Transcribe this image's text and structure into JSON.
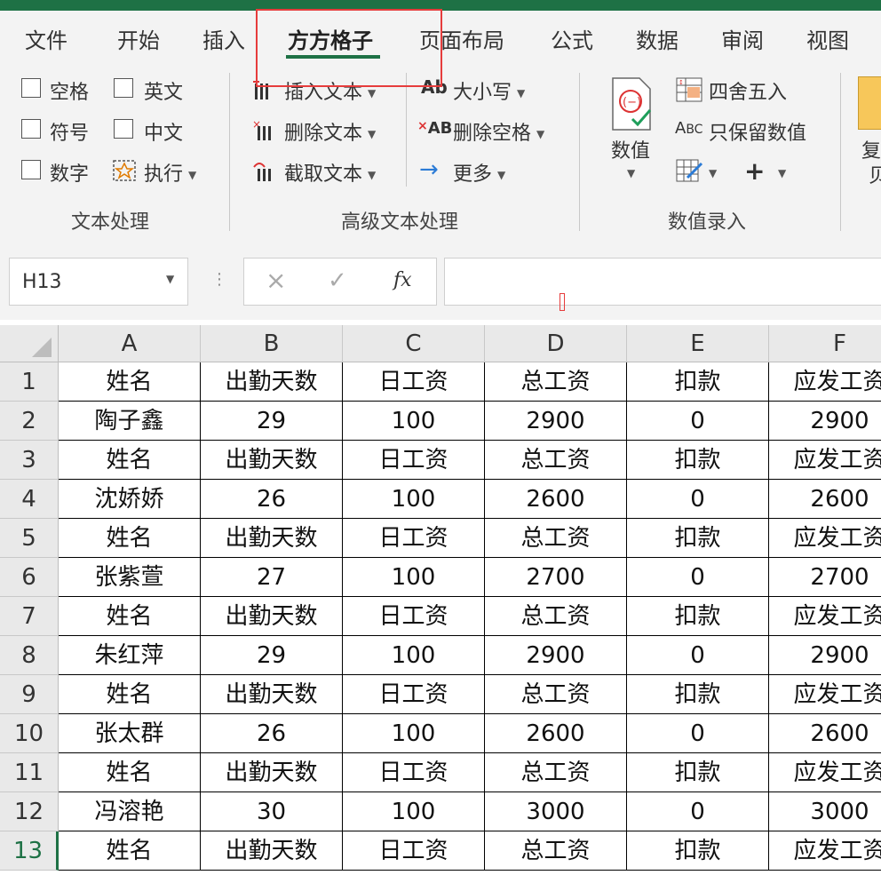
{
  "tabs": [
    {
      "id": "file",
      "label": "文件"
    },
    {
      "id": "home",
      "label": "开始"
    },
    {
      "id": "insert",
      "label": "插入"
    },
    {
      "id": "ffgz",
      "label": "方方格子"
    },
    {
      "id": "layout",
      "label": "页面布局"
    },
    {
      "id": "formula",
      "label": "公式"
    },
    {
      "id": "data",
      "label": "数据"
    },
    {
      "id": "review",
      "label": "审阅"
    },
    {
      "id": "view",
      "label": "视图"
    }
  ],
  "ribbon": {
    "text_group": {
      "title": "文本处理",
      "checkboxes": [
        "空格",
        "英文",
        "符号",
        "中文",
        "数字"
      ],
      "execute": "执行"
    },
    "adv_group": {
      "title": "高级文本处理",
      "insert_text": "插入文本",
      "delete_text": "删除文本",
      "extract_text": "截取文本",
      "case": "大小写",
      "delete_space": "删除空格",
      "more": "更多"
    },
    "num_group": {
      "title": "数值录入",
      "value": "数值",
      "round": "四舍五入",
      "keep_value": "只保留数值"
    },
    "partial": {
      "line1": "复",
      "line2": "贝"
    }
  },
  "formula_bar": {
    "name_box": "H13",
    "fx": "fx"
  },
  "columns": [
    "A",
    "B",
    "C",
    "D",
    "E",
    "F"
  ],
  "rows": [
    [
      "姓名",
      "出勤天数",
      "日工资",
      "总工资",
      "扣款",
      "应发工资"
    ],
    [
      "陶子鑫",
      "29",
      "100",
      "2900",
      "0",
      "2900"
    ],
    [
      "姓名",
      "出勤天数",
      "日工资",
      "总工资",
      "扣款",
      "应发工资"
    ],
    [
      "沈娇娇",
      "26",
      "100",
      "2600",
      "0",
      "2600"
    ],
    [
      "姓名",
      "出勤天数",
      "日工资",
      "总工资",
      "扣款",
      "应发工资"
    ],
    [
      "张紫萱",
      "27",
      "100",
      "2700",
      "0",
      "2700"
    ],
    [
      "姓名",
      "出勤天数",
      "日工资",
      "总工资",
      "扣款",
      "应发工资"
    ],
    [
      "朱红萍",
      "29",
      "100",
      "2900",
      "0",
      "2900"
    ],
    [
      "姓名",
      "出勤天数",
      "日工资",
      "总工资",
      "扣款",
      "应发工资"
    ],
    [
      "张太群",
      "26",
      "100",
      "2600",
      "0",
      "2600"
    ],
    [
      "姓名",
      "出勤天数",
      "日工资",
      "总工资",
      "扣款",
      "应发工资"
    ],
    [
      "冯溶艳",
      "30",
      "100",
      "3000",
      "0",
      "3000"
    ],
    [
      "姓名",
      "出勤天数",
      "日工资",
      "总工资",
      "扣款",
      "应发工资"
    ]
  ],
  "row_numbers": [
    "1",
    "2",
    "3",
    "4",
    "5",
    "6",
    "7",
    "8",
    "9",
    "10",
    "11",
    "12",
    "13"
  ],
  "selected_row": "13",
  "colors": {
    "accent": "#1e7145",
    "highlight": "#e63c3c"
  }
}
